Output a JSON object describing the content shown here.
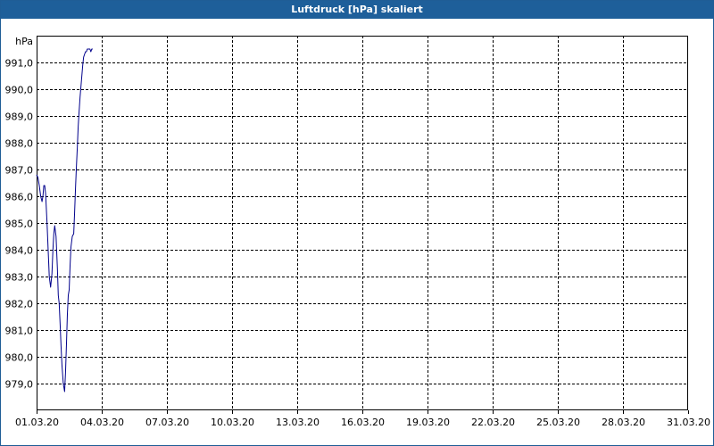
{
  "window": {
    "title": "Luftdruck [hPa] skaliert"
  },
  "chart_data": {
    "type": "line",
    "title": "Luftdruck [hPa] skaliert",
    "ylabel": "hPa",
    "xlabel": "",
    "ylim": [
      978.0,
      992.0
    ],
    "y_ticks": [
      "979,0",
      "980,0",
      "981,0",
      "982,0",
      "983,0",
      "984,0",
      "985,0",
      "986,0",
      "987,0",
      "988,0",
      "989,0",
      "990,0",
      "991,0"
    ],
    "x_range": [
      "2020-03-01",
      "2020-03-31"
    ],
    "x_ticks": [
      "01.03.20",
      "04.03.20",
      "07.03.20",
      "10.03.20",
      "13.03.20",
      "16.03.20",
      "19.03.20",
      "22.03.20",
      "25.03.20",
      "28.03.20",
      "31.03.20"
    ],
    "grid": true,
    "line_color": "#00008b",
    "series": [
      {
        "x": [
          "2020-03-01 00:00",
          "2020-03-01 01:30",
          "2020-03-01 03:00",
          "2020-03-01 04:30",
          "2020-03-01 06:00",
          "2020-03-01 07:00",
          "2020-03-01 08:00",
          "2020-03-01 09:00",
          "2020-03-01 10:00",
          "2020-03-01 11:30",
          "2020-03-01 13:00",
          "2020-03-01 14:00",
          "2020-03-01 15:30",
          "2020-03-01 17:00",
          "2020-03-01 18:00",
          "2020-03-01 19:00",
          "2020-03-01 20:00",
          "2020-03-01 21:30",
          "2020-03-01 23:00",
          "2020-03-02 00:00",
          "2020-03-02 01:00",
          "2020-03-02 02:00",
          "2020-03-02 03:00",
          "2020-03-02 04:00",
          "2020-03-02 05:30",
          "2020-03-02 07:00",
          "2020-03-02 08:00",
          "2020-03-02 09:00",
          "2020-03-02 10:00",
          "2020-03-02 11:00",
          "2020-03-02 12:00",
          "2020-03-02 13:00",
          "2020-03-02 14:00",
          "2020-03-02 15:30",
          "2020-03-02 17:00",
          "2020-03-02 18:00",
          "2020-03-02 19:00",
          "2020-03-02 20:00",
          "2020-03-02 21:00",
          "2020-03-02 22:00",
          "2020-03-02 23:00",
          "2020-03-03 00:00",
          "2020-03-03 01:00",
          "2020-03-03 02:00",
          "2020-03-03 03:00",
          "2020-03-03 04:00",
          "2020-03-03 05:00",
          "2020-03-03 06:00",
          "2020-03-03 07:00",
          "2020-03-03 08:00",
          "2020-03-03 09:00",
          "2020-03-03 10:00",
          "2020-03-03 11:00",
          "2020-03-03 12:00",
          "2020-03-03 13:00",
          "2020-03-03 14:00"
        ],
        "y": [
          986.8,
          986.7,
          986.4,
          986.0,
          985.8,
          986.0,
          986.4,
          986.4,
          986.1,
          985.0,
          983.8,
          983.0,
          982.6,
          983.1,
          984.0,
          984.6,
          984.9,
          984.5,
          983.3,
          982.3,
          982.0,
          981.2,
          980.4,
          979.7,
          979.0,
          978.7,
          979.4,
          980.5,
          981.6,
          982.3,
          982.5,
          983.4,
          984.1,
          984.5,
          984.6,
          985.4,
          986.3,
          987.1,
          987.8,
          988.6,
          989.2,
          989.7,
          990.1,
          990.5,
          990.9,
          991.2,
          991.3,
          991.4,
          991.4,
          991.5,
          991.5,
          991.5,
          991.5,
          991.4,
          991.5,
          991.5
        ]
      }
    ]
  }
}
